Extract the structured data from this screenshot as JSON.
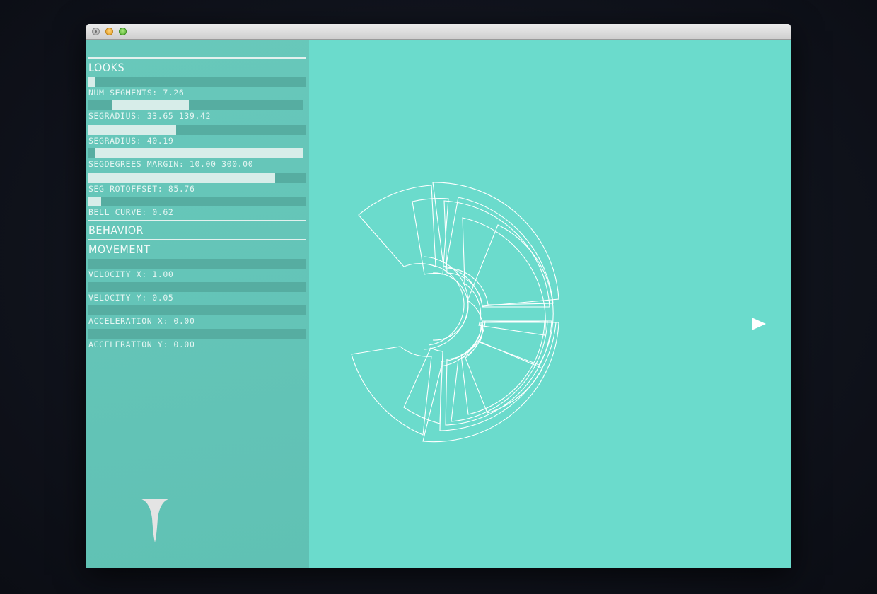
{
  "window": {
    "buttons": [
      "close",
      "minimize",
      "zoom"
    ]
  },
  "panel": {
    "sections": {
      "looks": "LOOKS",
      "behavior": "BEHAVIOR",
      "movement": "MOVEMENT"
    },
    "sliders": [
      {
        "label": "NUM SEGMENTS: 7.26",
        "value": 0.02
      },
      {
        "label": "SEGRADIUS: 33.65 139.42",
        "range": [
          0.11,
          0.46
        ]
      },
      {
        "label": "SEGRADIUS: 40.19",
        "value": 0.4
      },
      {
        "label": "SEGDEGREES MARGIN: 10.00 300.00",
        "range": [
          0.03,
          1.0
        ]
      },
      {
        "label": "SEG ROTOFFSET: 85.76",
        "value": 0.86
      },
      {
        "label": "BELL CURVE: 0.62",
        "value": 0.06
      },
      {
        "label": "VELOCITY X: 1.00",
        "value": 0.0
      },
      {
        "label": "VELOCITY Y: 0.05",
        "value": 0.0
      },
      {
        "label": "ACCELERATION X: 0.00",
        "value": 0.0
      },
      {
        "label": "ACCELERATION Y: 0.00",
        "value": 0.0
      }
    ]
  },
  "icons": {
    "bell_curve": "bell-curve-icon",
    "play": "play-icon"
  },
  "colors": {
    "background": "#6bdbcc",
    "panel": "#62c4b7",
    "track": "#56ada1",
    "fill": "#d7ede9",
    "lines": "#ffffff"
  }
}
